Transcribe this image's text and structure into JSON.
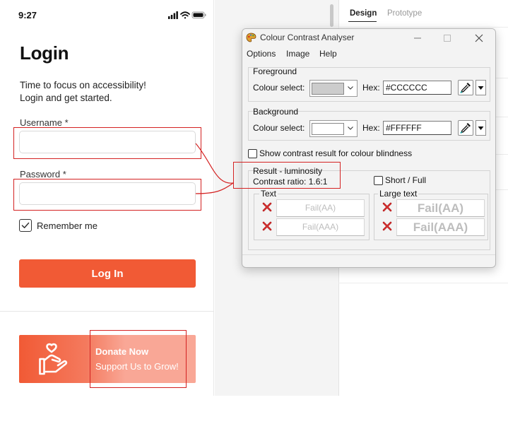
{
  "phone": {
    "status_time": "9:27",
    "title": "Login",
    "subtitle_line1": "Time to focus on accessibility!",
    "subtitle_line2": "Login and get started.",
    "username_label": "Username *",
    "password_label": "Password *",
    "remember_label": "Remember me",
    "remember_checked": true,
    "login_button": "Log In",
    "donate_title": "Donate Now",
    "donate_subtitle": "Support Us to Grow!",
    "brand_color": "#F15A35"
  },
  "design_app": {
    "tabs": [
      "Design",
      "Prototype"
    ],
    "active_tab": "Design"
  },
  "cca": {
    "window_title": "Colour Contrast Analyser",
    "menu": [
      "Options",
      "Image",
      "Help"
    ],
    "foreground": {
      "group_label": "Foreground",
      "select_label": "Colour select:",
      "hex_label": "Hex:",
      "hex_value": "#CCCCCC",
      "swatch_color": "#CCCCCC"
    },
    "background": {
      "group_label": "Background",
      "select_label": "Colour select:",
      "hex_label": "Hex:",
      "hex_value": "#FFFFFF",
      "swatch_color": "#FFFFFF"
    },
    "blindness_option": "Show contrast result for colour blindness",
    "result": {
      "group_label": "Result - luminosity",
      "contrast_ratio": "Contrast ratio: 1.6:1",
      "short_full": "Short / Full",
      "text_label": "Text",
      "large_text_label": "Large text",
      "text_aa": "Fail(AA)",
      "text_aaa": "Fail(AAA)",
      "large_aa": "Fail(AA)",
      "large_aaa": "Fail(AAA)"
    }
  }
}
